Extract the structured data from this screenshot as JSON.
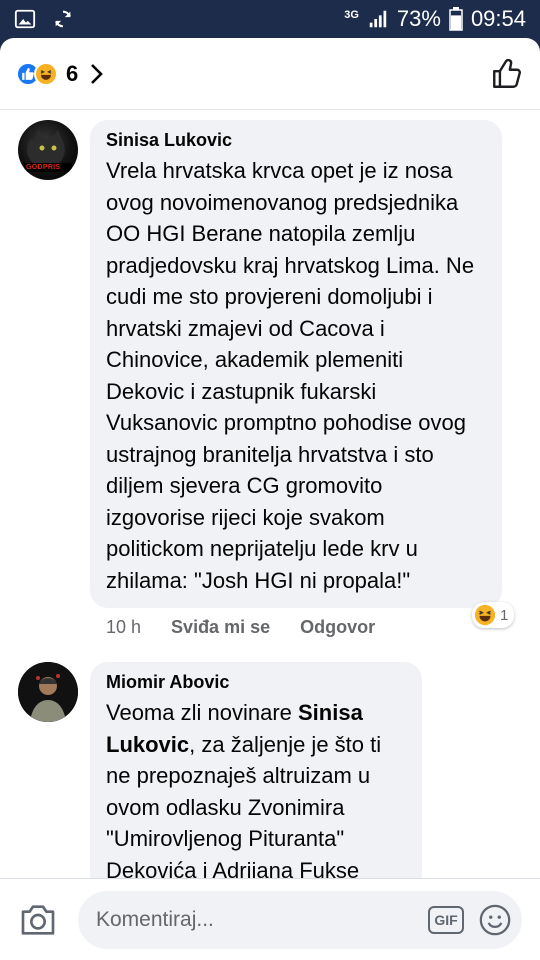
{
  "status_bar": {
    "network_type": "3G",
    "battery_percent": "73%",
    "battery_level": 0.73,
    "time": "09:54",
    "icons": [
      "gallery-icon",
      "sync-icon",
      "signal-icon",
      "battery-icon"
    ]
  },
  "reactions_header": {
    "icons": [
      "like-icon",
      "haha-icon"
    ],
    "count": "6"
  },
  "comments": [
    {
      "author": "Sinisa Lukovic",
      "avatar_text": "GODPRIS",
      "text": "Vrela hrvatska krvca opet je iz nosa ovog  novoimenovanog predsjednika OO HGI Berane natopila zemlju pradjedovsku kraj hrvatskog Lima. Ne cudi me sto provjereni domoljubi i hrvatski zmajevi od Cacova i Chinovice, akademik plemeniti Dekovic i zastupnik fukarski Vuksanovic promptno pohodise ovog ustrajnog branitelja hrvatstva i sto diljem sjevera CG gromovito izgovorise rijeci koje svakom politickom neprijatelju lede krv u zhilama: \"Josh HGI ni propala!\"",
      "time": "10 h",
      "like_label": "Sviđa mi se",
      "reply_label": "Odgovor",
      "reaction_icon": "haha-icon",
      "reaction_count": "1"
    },
    {
      "author": "Miomir Abovic",
      "text_part1": "Veoma zli novinare ",
      "mention": "Sinisa Lukovic",
      "text_part2": ", za žaljenje je što ti ne prepoznaješ altruizam u ovom odlasku Zvonimira \"Umirovljenog Pituranta\" Dekovića i Adrijana Fukse Vuksanovića u Berane, nego- u"
    }
  ],
  "composer": {
    "placeholder": "Komentiraj...",
    "gif_label": "GIF",
    "icons": [
      "camera-icon",
      "emoji-icon"
    ]
  },
  "colors": {
    "status_bar_bg": "#1d2c4a",
    "bubble_bg": "#f0f2f5",
    "like_blue": "#1877f2",
    "haha_yellow": "#f7b125",
    "meta_gray": "#65676b"
  }
}
